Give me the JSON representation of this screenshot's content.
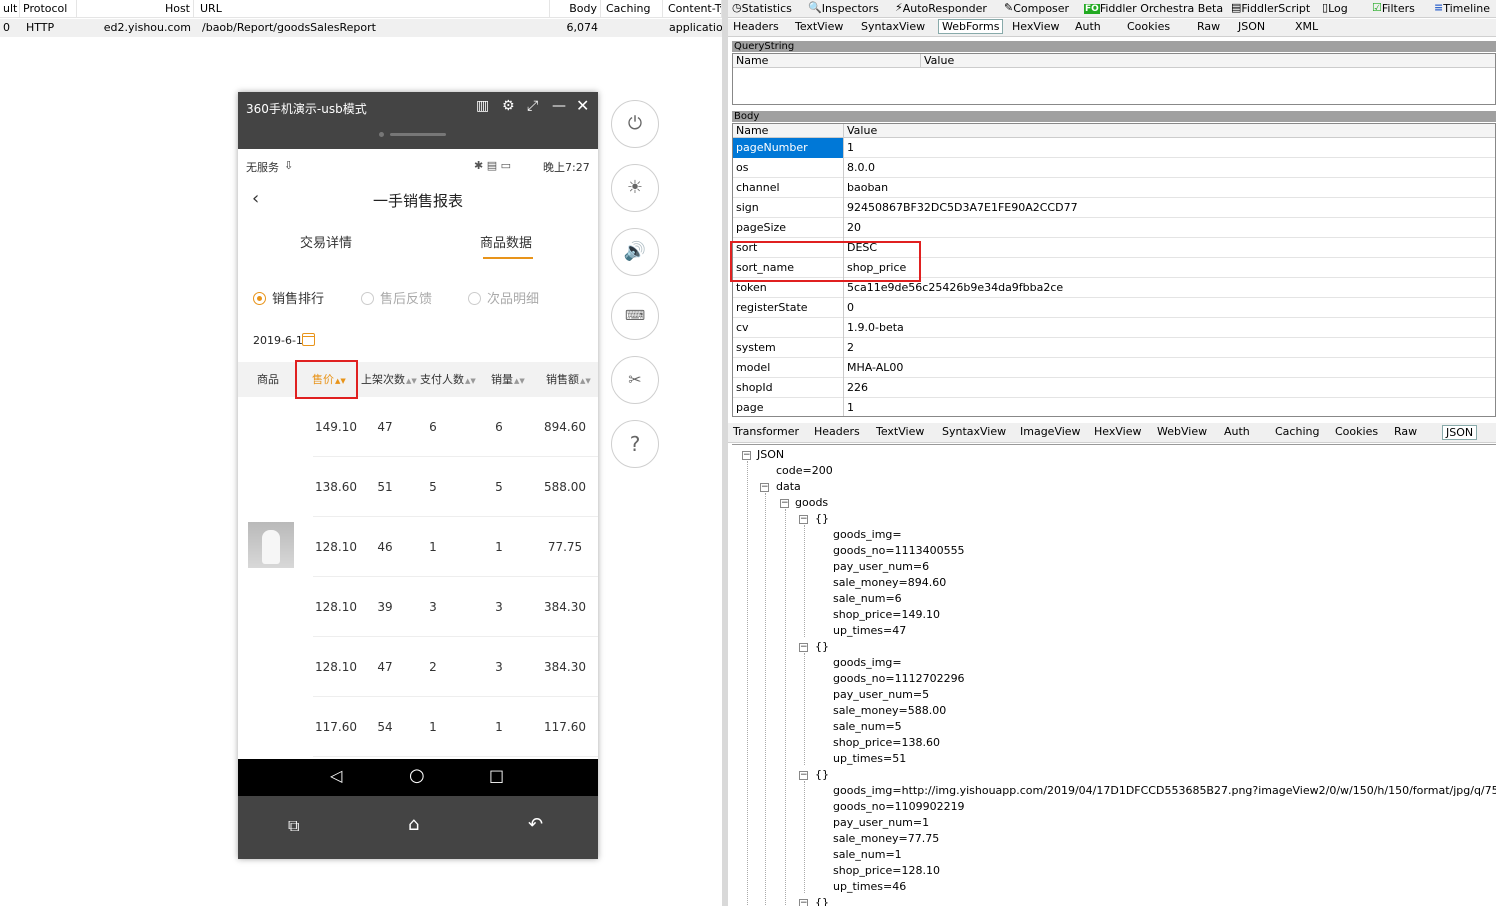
{
  "session_list": {
    "columns": [
      "ult",
      "Protocol",
      "Host",
      "URL",
      "Body",
      "Caching",
      "Content-Ty"
    ],
    "row": {
      "result": "0",
      "protocol": "HTTP",
      "host": "ed2.yishou.com",
      "url": "/baob/Report/goodsSalesReport",
      "body": "6,074",
      "caching": "",
      "content_type": "application"
    }
  },
  "phone": {
    "window_title": "360手机演示-usb模式",
    "status_left": "无服务",
    "status_time": "晚上7:27",
    "page_title": "一手销售报表",
    "tabs": [
      "交易详情",
      "商品数据"
    ],
    "radios": [
      "销售排行",
      "售后反馈",
      "次品明细"
    ],
    "date": "2019-6-1",
    "columns": [
      "商品",
      "售价",
      "上架次数",
      "支付人数",
      "销量",
      "销售额"
    ],
    "rows": [
      {
        "price": "149.10",
        "up": "47",
        "payers": "6",
        "sales": "6",
        "amount": "894.60"
      },
      {
        "price": "138.60",
        "up": "51",
        "payers": "5",
        "sales": "5",
        "amount": "588.00"
      },
      {
        "price": "128.10",
        "up": "46",
        "payers": "1",
        "sales": "1",
        "amount": "77.75"
      },
      {
        "price": "128.10",
        "up": "39",
        "payers": "3",
        "sales": "3",
        "amount": "384.30"
      },
      {
        "price": "128.10",
        "up": "47",
        "payers": "2",
        "sales": "3",
        "amount": "384.30"
      },
      {
        "price": "117.60",
        "up": "54",
        "payers": "1",
        "sales": "1",
        "amount": "117.60"
      }
    ]
  },
  "side_buttons": [
    "power-icon",
    "brightness-icon",
    "volume-icon",
    "keyboard-icon",
    "crop-icon",
    "help-icon"
  ],
  "inspector": {
    "top_tabs": [
      "Statistics",
      "Inspectors",
      "AutoResponder",
      "Composer",
      "Fiddler Orchestra Beta",
      "FiddlerScript",
      "Log",
      "Filters",
      "Timeline"
    ],
    "request_tabs": [
      "Headers",
      "TextView",
      "SyntaxView",
      "WebForms",
      "HexView",
      "Auth",
      "Cookies",
      "Raw",
      "JSON",
      "XML"
    ],
    "querystring_label": "QueryString",
    "body_label": "Body",
    "col_name": "Name",
    "col_value": "Value",
    "body_rows": [
      {
        "k": "pageNumber",
        "v": "1"
      },
      {
        "k": "os",
        "v": "8.0.0"
      },
      {
        "k": "channel",
        "v": "baoban"
      },
      {
        "k": "sign",
        "v": "92450867BF32DC5D3A7E1FE90A2CCD77"
      },
      {
        "k": "pageSize",
        "v": "20"
      },
      {
        "k": "sort",
        "v": "DESC"
      },
      {
        "k": "sort_name",
        "v": "shop_price"
      },
      {
        "k": "token",
        "v": "5ca11e9de56c25426b9e34da9fbba2ce"
      },
      {
        "k": "registerState",
        "v": "0"
      },
      {
        "k": "cv",
        "v": "1.9.0-beta"
      },
      {
        "k": "system",
        "v": "2"
      },
      {
        "k": "model",
        "v": "MHA-AL00"
      },
      {
        "k": "shopId",
        "v": "226"
      },
      {
        "k": "page",
        "v": "1"
      }
    ],
    "response_tabs": [
      "Transformer",
      "Headers",
      "TextView",
      "SyntaxView",
      "ImageView",
      "HexView",
      "WebView",
      "Auth",
      "Caching",
      "Cookies",
      "Raw",
      "JSON"
    ],
    "tree": {
      "root": "JSON",
      "code": "code=200",
      "data": "data",
      "goods": "goods",
      "obj": "{}",
      "items": [
        [
          "goods_img=",
          "goods_no=1113400555",
          "pay_user_num=6",
          "sale_money=894.60",
          "sale_num=6",
          "shop_price=149.10",
          "up_times=47"
        ],
        [
          "goods_img=",
          "goods_no=1112702296",
          "pay_user_num=5",
          "sale_money=588.00",
          "sale_num=5",
          "shop_price=138.60",
          "up_times=51"
        ],
        [
          "goods_img=http://img.yishouapp.com/2019/04/17D1DFCCD553685B27.png?imageView2/0/w/150/h/150/format/jpg/q/75/",
          "goods_no=1109902219",
          "pay_user_num=1",
          "sale_money=77.75",
          "sale_num=1",
          "shop_price=128.10",
          "up_times=46"
        ]
      ]
    }
  }
}
